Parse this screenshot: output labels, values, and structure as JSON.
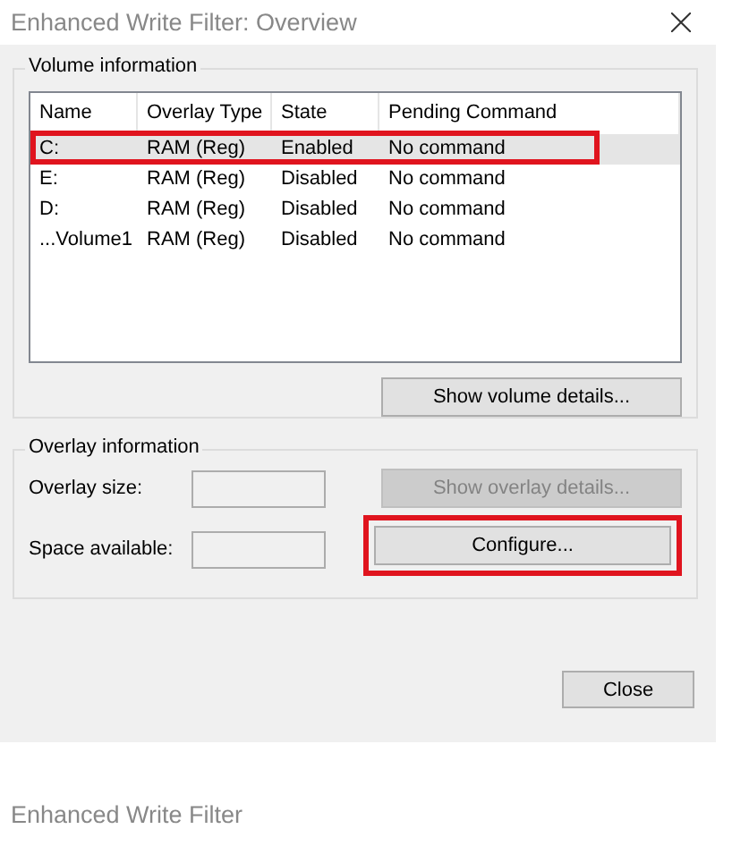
{
  "window": {
    "title": "Enhanced Write Filter: Overview"
  },
  "volume_group": {
    "title": "Volume information",
    "columns": [
      "Name",
      "Overlay Type",
      "State",
      "Pending Command"
    ],
    "rows": [
      {
        "cells": [
          "C:",
          "RAM (Reg)",
          "Enabled",
          "No command"
        ],
        "selected": true,
        "highlighted": true
      },
      {
        "cells": [
          "E:",
          "RAM (Reg)",
          "Disabled",
          "No command"
        ],
        "selected": false,
        "highlighted": false
      },
      {
        "cells": [
          "D:",
          "RAM (Reg)",
          "Disabled",
          "No command"
        ],
        "selected": false,
        "highlighted": false
      },
      {
        "cells": [
          "...Volume1",
          "RAM (Reg)",
          "Disabled",
          "No command"
        ],
        "selected": false,
        "highlighted": false
      }
    ],
    "button": {
      "label": "Show volume details..."
    }
  },
  "overlay_group": {
    "title": "Overlay information",
    "fields": [
      {
        "label": "Overlay size:"
      },
      {
        "label": "Space available:"
      }
    ],
    "buttons": [
      {
        "label": "Show overlay details...",
        "disabled": true,
        "highlighted": false
      },
      {
        "label": "Configure...",
        "disabled": false,
        "highlighted": true
      }
    ]
  },
  "close_button": {
    "label": "Close"
  },
  "next_window": {
    "title": "Enhanced Write Filter"
  }
}
